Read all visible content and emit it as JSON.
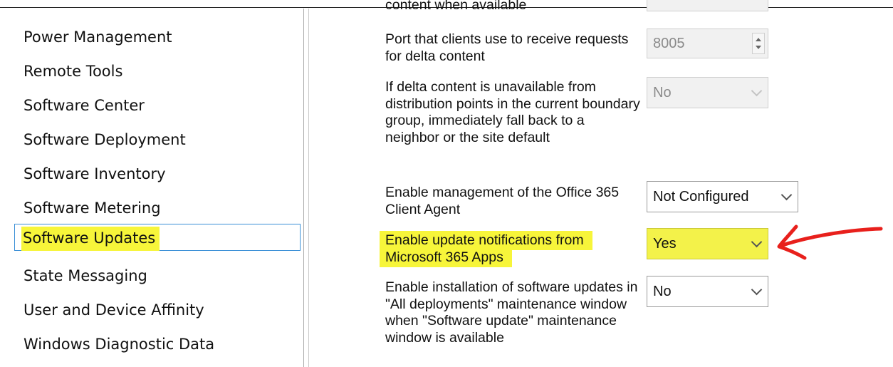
{
  "nav": {
    "items": [
      {
        "label": "Power Management"
      },
      {
        "label": "Remote Tools"
      },
      {
        "label": "Software Center"
      },
      {
        "label": "Software Deployment"
      },
      {
        "label": "Software Inventory"
      },
      {
        "label": "Software Metering"
      },
      {
        "label": "Software Updates",
        "selected": true
      },
      {
        "label": "State Messaging"
      },
      {
        "label": "User and Device Affinity"
      },
      {
        "label": "Windows Diagnostic Data"
      }
    ]
  },
  "settings": {
    "cut_top_label": "content when available",
    "port": {
      "label": "Port that clients use to receive requests for delta content",
      "value": "8005"
    },
    "delta_fallback": {
      "label": "If delta content is unavailable from distribution points in the current boundary group, immediately fall back to a neighbor or the site default",
      "value": "No"
    },
    "office_agent": {
      "label": "Enable management of the Office 365 Client Agent",
      "value": "Not Configured"
    },
    "update_notifications": {
      "label": "Enable update notifications from Microsoft 365 Apps",
      "value": "Yes"
    },
    "install_in_window": {
      "label": "Enable installation of software updates in \"All deployments\" maintenance window when \"Software update\" maintenance window is available",
      "value": "No"
    }
  },
  "colors": {
    "highlight": "#f7f53a",
    "annotation_arrow": "#e8201c",
    "selection_border": "#3a8fd6"
  }
}
